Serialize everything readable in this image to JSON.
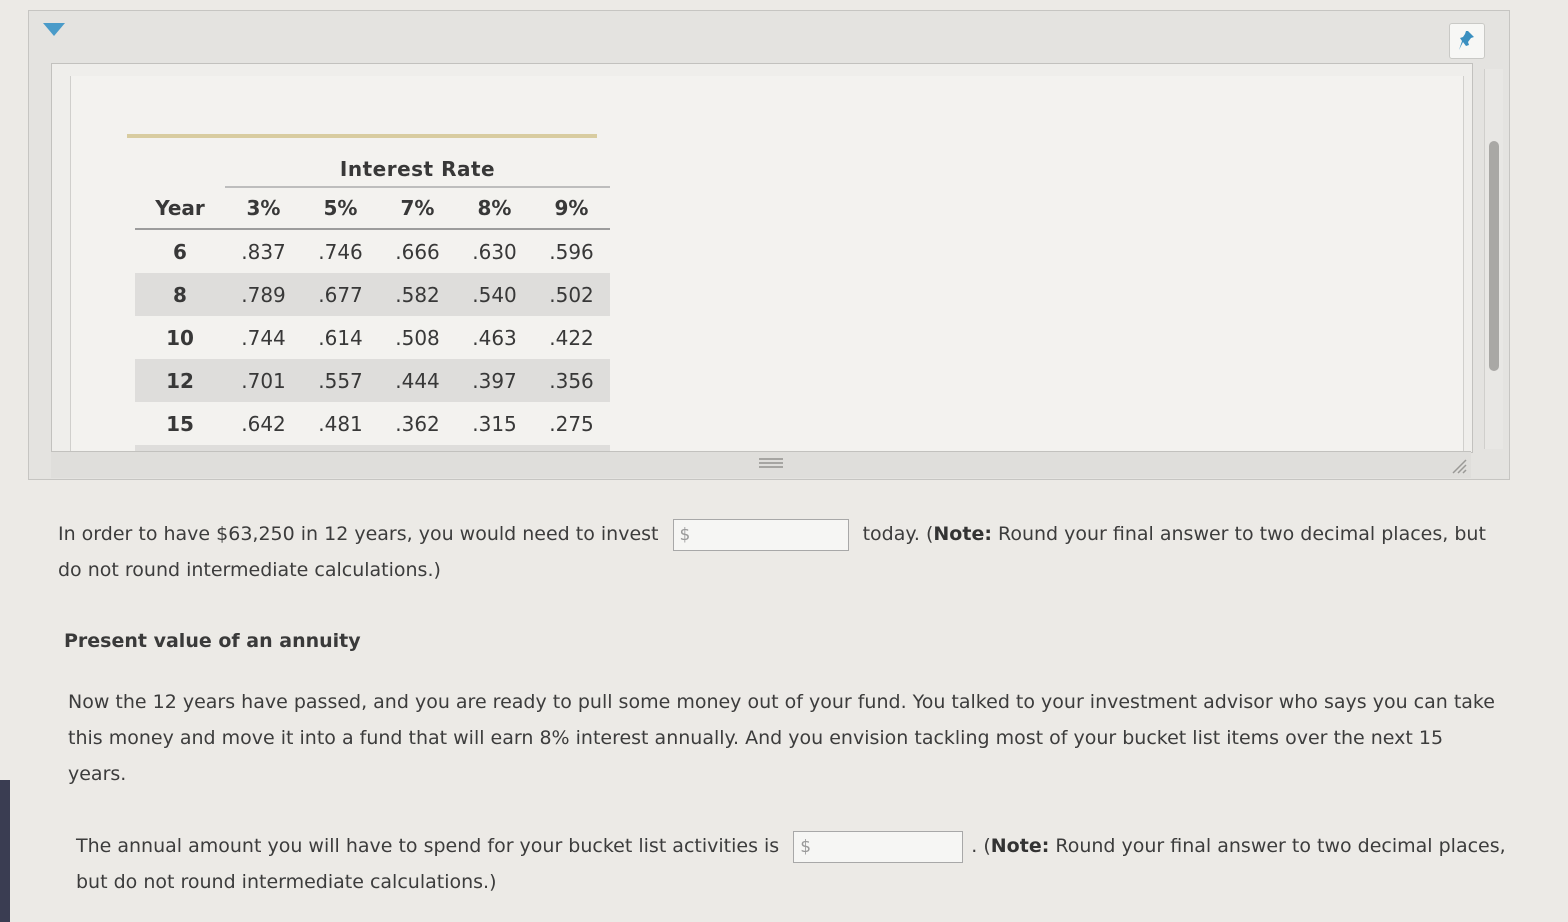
{
  "table": {
    "group_header": "Interest Rate",
    "year_header": "Year",
    "rate_headers": [
      "3%",
      "5%",
      "7%",
      "8%",
      "9%"
    ],
    "rows": [
      {
        "year": "6",
        "values": [
          ".837",
          ".746",
          ".666",
          ".630",
          ".596"
        ]
      },
      {
        "year": "8",
        "values": [
          ".789",
          ".677",
          ".582",
          ".540",
          ".502"
        ]
      },
      {
        "year": "10",
        "values": [
          ".744",
          ".614",
          ".508",
          ".463",
          ".422"
        ]
      },
      {
        "year": "12",
        "values": [
          ".701",
          ".557",
          ".444",
          ".397",
          ".356"
        ]
      },
      {
        "year": "15",
        "values": [
          ".642",
          ".481",
          ".362",
          ".315",
          ".275"
        ]
      }
    ]
  },
  "question1": {
    "prefix": "In order to have $63,250 in 12 years, you would need to invest",
    "currency": "$",
    "value": "",
    "suffix_text": "today. (",
    "note_label": "Note:",
    "note_text": " Round your final answer to two decimal places, but",
    "line2": "do not round intermediate calculations.)"
  },
  "section": {
    "title": "Present value of an annuity",
    "para_line1": "Now the 12 years have passed, and you are ready to pull some money out of your fund. You talked to your investment advisor who says you can take",
    "para_line2": "this money and move it into a fund that will earn 8% interest annually. And you envision tackling most of your bucket list items over the next 15",
    "para_line3": "years."
  },
  "question2": {
    "prefix": "The annual amount you will have to spend for your bucket list activities is",
    "currency": "$",
    "value": "",
    "suffix_text": ". (",
    "note_label": "Note:",
    "note_text": " Round your final answer to two decimal places,",
    "line2": "but do not round intermediate calculations.)"
  },
  "icons": {
    "toggle": "collapse-arrow-icon",
    "pin": "pin-icon",
    "grip": "resize-grip-icon",
    "corner": "resize-corner-icon"
  },
  "colors": {
    "accent_arrow": "#4a9bc9",
    "table_shade": "#dedddb",
    "rule": "#d8cca0"
  }
}
